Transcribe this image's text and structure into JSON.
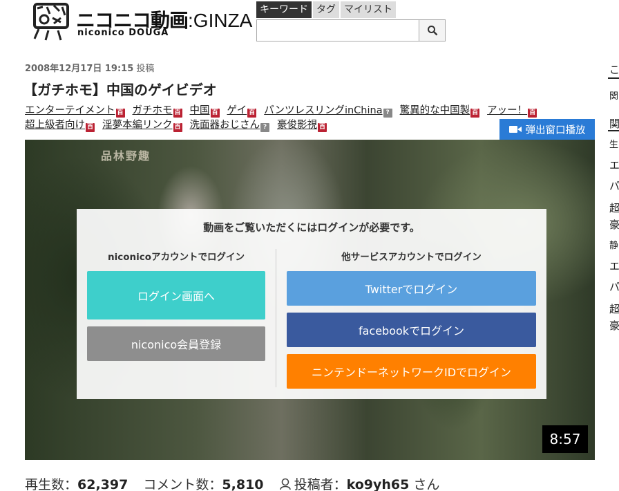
{
  "header": {
    "logo_jp": "ニコニコ動画",
    "logo_ginza": ":GINZA",
    "logo_en": "niconico DOUGA"
  },
  "search": {
    "tabs": [
      "キーワード",
      "タグ",
      "マイリスト"
    ],
    "active_tab": 0,
    "placeholder": "",
    "value": ""
  },
  "video": {
    "date": "2008年12月17日 19:15",
    "posted_label": "投稿",
    "title": "【ガチホモ】中国のゲイビデオ",
    "tags_row1": [
      {
        "label": "エンターテイメント",
        "dic": true
      },
      {
        "label": "ガチホモ",
        "dic": true
      },
      {
        "label": "中国",
        "dic": true
      },
      {
        "label": "ゲイ",
        "dic": true
      },
      {
        "label": "パンツレスリングinChina",
        "dic": false
      },
      {
        "label": "驚異的な中国製",
        "dic": true
      },
      {
        "label": "アッー！",
        "dic": true
      }
    ],
    "tags_row2": [
      {
        "label": "超上級者向け",
        "dic": true
      },
      {
        "label": "淫夢本編リンク",
        "dic": true
      },
      {
        "label": "洗面器おじさん",
        "dic": false
      },
      {
        "label": "豪俊影視",
        "dic": true
      }
    ],
    "popup_label": "弾出窗口播放",
    "player_caption": "品林野趣",
    "duration": "8:57"
  },
  "login_overlay": {
    "title": "動画をご覧いただくにはログインが必要です。",
    "left_head": "niconicoアカウントでログイン",
    "login_button": "ログイン画面へ",
    "register_button": "niconico会員登録",
    "right_head": "他サービスアカウントでログイン",
    "twitter_button": "Twitterでログイン",
    "facebook_button": "facebookでログイン",
    "nintendo_button": "ニンテンドーネットワークIDでログイン"
  },
  "stats": {
    "views_label": "再生数：",
    "views": "62,397",
    "comments_label": "コメント数：",
    "comments": "5,810",
    "uploader_label": "投稿者：",
    "uploader": "ko9yh65",
    "uploader_suffix": "さん"
  },
  "sidebar_edge": [
    "こ",
    "関",
    "関",
    "生",
    "エ",
    "パ",
    "超",
    "豪",
    "静",
    "エ",
    "パ",
    "超",
    "豪"
  ],
  "colors": {
    "accent_blue": "#2a7bd6",
    "login_teal": "#3ecfcb",
    "register_gray": "#8e8e8e",
    "twitter": "#5aa0de",
    "facebook": "#3a5a9e",
    "nintendo": "#ff8000",
    "dic_icon": "#b23"
  }
}
